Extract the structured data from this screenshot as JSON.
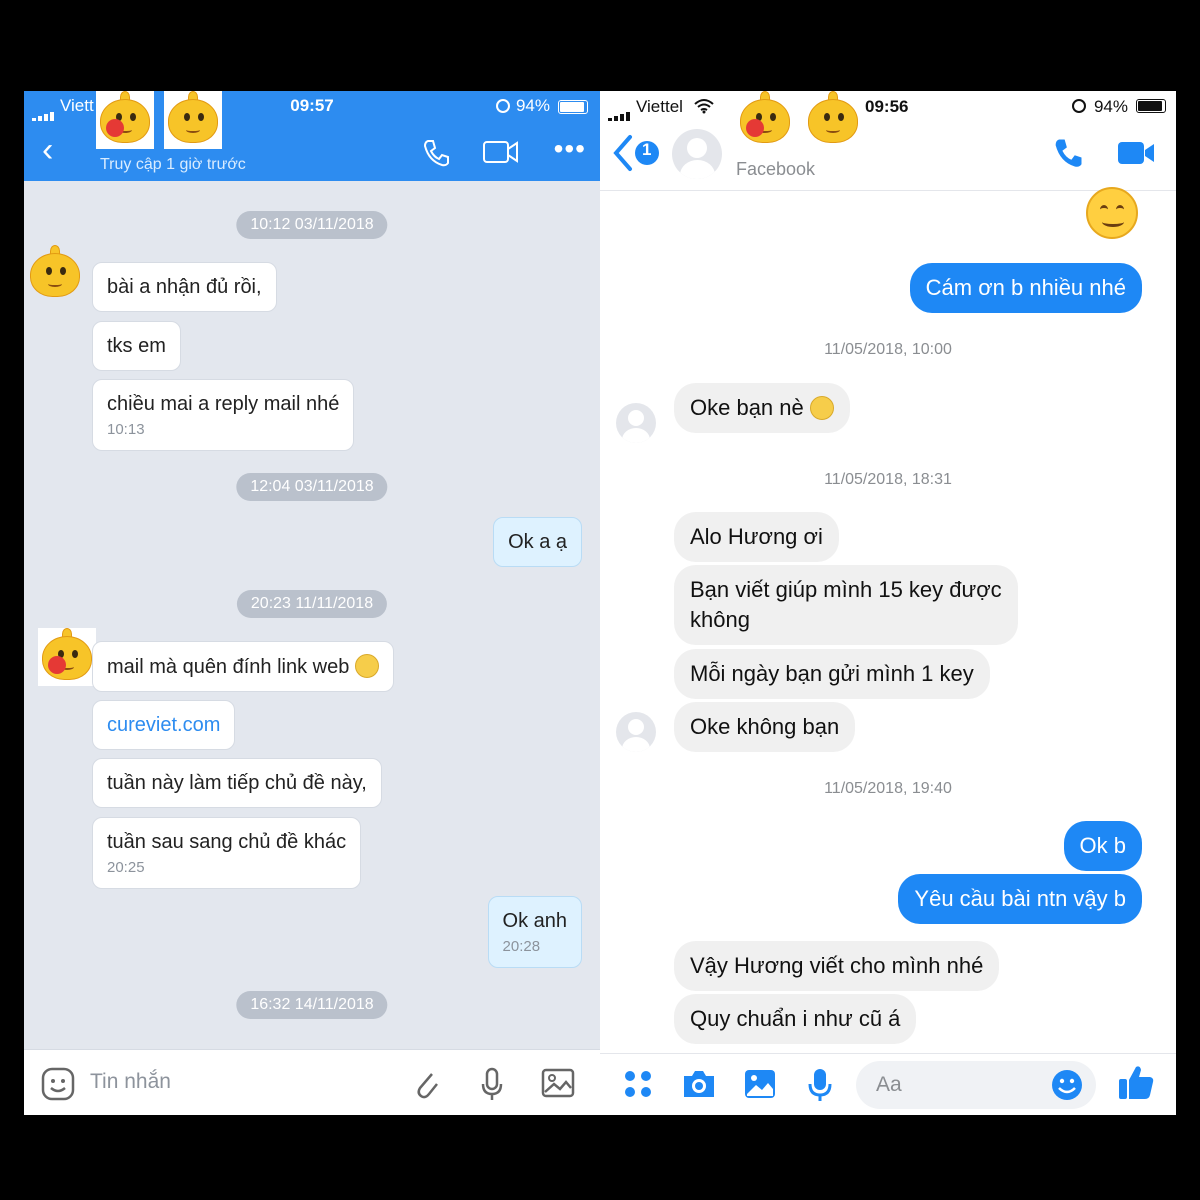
{
  "left": {
    "status": {
      "carrier": "Viett",
      "time": "09:57",
      "battery": "94%"
    },
    "header": {
      "subtitle": "Truy cập 1 giờ trước"
    },
    "messages": [
      {
        "stamp": "10:12 03/11/2018"
      },
      {
        "text": "bài a nhận đủ rồi,"
      },
      {
        "text": "tks em"
      },
      {
        "text": "chiều mai a reply mail nhé",
        "time": "10:13"
      },
      {
        "stamp": "12:04 03/11/2018"
      },
      {
        "text": "Ok a ạ"
      },
      {
        "stamp": "20:23 11/11/2018"
      },
      {
        "text": "mail mà quên đính link web"
      },
      {
        "text": "cureviet.com"
      },
      {
        "text": "tuần này làm tiếp chủ đề này,"
      },
      {
        "text": "tuần sau sang chủ đề khác",
        "time": "20:25"
      },
      {
        "text": "Ok anh",
        "time": "20:28"
      },
      {
        "stamp": "16:32 14/11/2018"
      }
    ],
    "input": {
      "placeholder": "Tin nhắn"
    }
  },
  "right": {
    "status": {
      "carrier": "Viettel",
      "time": "09:56",
      "battery": "94%"
    },
    "header": {
      "back_badge": "1",
      "subtitle": "Facebook"
    },
    "messages": [
      {
        "text": "Cám ơn b nhiều nhé"
      },
      {
        "stamp": "11/05/2018, 10:00"
      },
      {
        "text": "Oke bạn nè"
      },
      {
        "stamp": "11/05/2018, 18:31"
      },
      {
        "text": "Alo Hương ơi"
      },
      {
        "text": "Bạn viết giúp mình 15 key được"
      },
      {
        "text": "không"
      },
      {
        "text": "Mỗi ngày bạn gửi mình 1 key"
      },
      {
        "text": "Oke không bạn"
      },
      {
        "stamp": "11/05/2018, 19:40"
      },
      {
        "text": "Ok b"
      },
      {
        "text": "Yêu cầu bài ntn vậy b"
      },
      {
        "text": "Vậy Hương viết cho mình nhé"
      },
      {
        "text": "Quy chuẩn i như cũ á"
      }
    ],
    "input": {
      "placeholder": "Aa"
    }
  },
  "colors": {
    "zalo_blue": "#2d8cf0",
    "messenger_blue": "#1e88f5"
  }
}
